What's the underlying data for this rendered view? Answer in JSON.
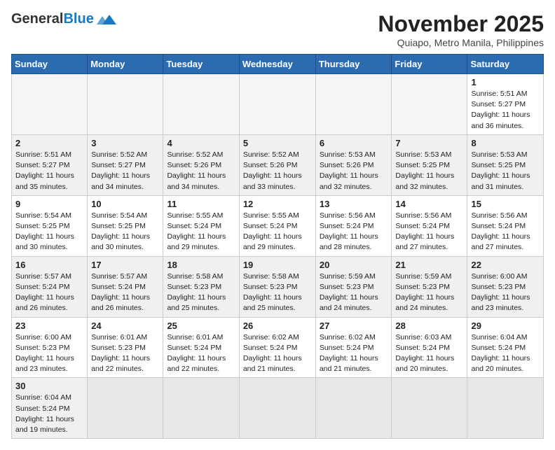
{
  "logo": {
    "general": "General",
    "blue": "Blue"
  },
  "header": {
    "month": "November 2025",
    "location": "Quiapo, Metro Manila, Philippines"
  },
  "weekdays": [
    "Sunday",
    "Monday",
    "Tuesday",
    "Wednesday",
    "Thursday",
    "Friday",
    "Saturday"
  ],
  "weeks": [
    [
      {
        "day": null,
        "info": null
      },
      {
        "day": null,
        "info": null
      },
      {
        "day": null,
        "info": null
      },
      {
        "day": null,
        "info": null
      },
      {
        "day": null,
        "info": null
      },
      {
        "day": null,
        "info": null
      },
      {
        "day": "1",
        "info": "Sunrise: 5:51 AM\nSunset: 5:27 PM\nDaylight: 11 hours\nand 36 minutes."
      }
    ],
    [
      {
        "day": "2",
        "info": "Sunrise: 5:51 AM\nSunset: 5:27 PM\nDaylight: 11 hours\nand 35 minutes."
      },
      {
        "day": "3",
        "info": "Sunrise: 5:52 AM\nSunset: 5:27 PM\nDaylight: 11 hours\nand 34 minutes."
      },
      {
        "day": "4",
        "info": "Sunrise: 5:52 AM\nSunset: 5:26 PM\nDaylight: 11 hours\nand 34 minutes."
      },
      {
        "day": "5",
        "info": "Sunrise: 5:52 AM\nSunset: 5:26 PM\nDaylight: 11 hours\nand 33 minutes."
      },
      {
        "day": "6",
        "info": "Sunrise: 5:53 AM\nSunset: 5:26 PM\nDaylight: 11 hours\nand 32 minutes."
      },
      {
        "day": "7",
        "info": "Sunrise: 5:53 AM\nSunset: 5:25 PM\nDaylight: 11 hours\nand 32 minutes."
      },
      {
        "day": "8",
        "info": "Sunrise: 5:53 AM\nSunset: 5:25 PM\nDaylight: 11 hours\nand 31 minutes."
      }
    ],
    [
      {
        "day": "9",
        "info": "Sunrise: 5:54 AM\nSunset: 5:25 PM\nDaylight: 11 hours\nand 30 minutes."
      },
      {
        "day": "10",
        "info": "Sunrise: 5:54 AM\nSunset: 5:25 PM\nDaylight: 11 hours\nand 30 minutes."
      },
      {
        "day": "11",
        "info": "Sunrise: 5:55 AM\nSunset: 5:24 PM\nDaylight: 11 hours\nand 29 minutes."
      },
      {
        "day": "12",
        "info": "Sunrise: 5:55 AM\nSunset: 5:24 PM\nDaylight: 11 hours\nand 29 minutes."
      },
      {
        "day": "13",
        "info": "Sunrise: 5:56 AM\nSunset: 5:24 PM\nDaylight: 11 hours\nand 28 minutes."
      },
      {
        "day": "14",
        "info": "Sunrise: 5:56 AM\nSunset: 5:24 PM\nDaylight: 11 hours\nand 27 minutes."
      },
      {
        "day": "15",
        "info": "Sunrise: 5:56 AM\nSunset: 5:24 PM\nDaylight: 11 hours\nand 27 minutes."
      }
    ],
    [
      {
        "day": "16",
        "info": "Sunrise: 5:57 AM\nSunset: 5:24 PM\nDaylight: 11 hours\nand 26 minutes."
      },
      {
        "day": "17",
        "info": "Sunrise: 5:57 AM\nSunset: 5:24 PM\nDaylight: 11 hours\nand 26 minutes."
      },
      {
        "day": "18",
        "info": "Sunrise: 5:58 AM\nSunset: 5:23 PM\nDaylight: 11 hours\nand 25 minutes."
      },
      {
        "day": "19",
        "info": "Sunrise: 5:58 AM\nSunset: 5:23 PM\nDaylight: 11 hours\nand 25 minutes."
      },
      {
        "day": "20",
        "info": "Sunrise: 5:59 AM\nSunset: 5:23 PM\nDaylight: 11 hours\nand 24 minutes."
      },
      {
        "day": "21",
        "info": "Sunrise: 5:59 AM\nSunset: 5:23 PM\nDaylight: 11 hours\nand 24 minutes."
      },
      {
        "day": "22",
        "info": "Sunrise: 6:00 AM\nSunset: 5:23 PM\nDaylight: 11 hours\nand 23 minutes."
      }
    ],
    [
      {
        "day": "23",
        "info": "Sunrise: 6:00 AM\nSunset: 5:23 PM\nDaylight: 11 hours\nand 23 minutes."
      },
      {
        "day": "24",
        "info": "Sunrise: 6:01 AM\nSunset: 5:23 PM\nDaylight: 11 hours\nand 22 minutes."
      },
      {
        "day": "25",
        "info": "Sunrise: 6:01 AM\nSunset: 5:24 PM\nDaylight: 11 hours\nand 22 minutes."
      },
      {
        "day": "26",
        "info": "Sunrise: 6:02 AM\nSunset: 5:24 PM\nDaylight: 11 hours\nand 21 minutes."
      },
      {
        "day": "27",
        "info": "Sunrise: 6:02 AM\nSunset: 5:24 PM\nDaylight: 11 hours\nand 21 minutes."
      },
      {
        "day": "28",
        "info": "Sunrise: 6:03 AM\nSunset: 5:24 PM\nDaylight: 11 hours\nand 20 minutes."
      },
      {
        "day": "29",
        "info": "Sunrise: 6:04 AM\nSunset: 5:24 PM\nDaylight: 11 hours\nand 20 minutes."
      }
    ],
    [
      {
        "day": "30",
        "info": "Sunrise: 6:04 AM\nSunset: 5:24 PM\nDaylight: 11 hours\nand 19 minutes."
      },
      {
        "day": null,
        "info": null
      },
      {
        "day": null,
        "info": null
      },
      {
        "day": null,
        "info": null
      },
      {
        "day": null,
        "info": null
      },
      {
        "day": null,
        "info": null
      },
      {
        "day": null,
        "info": null
      }
    ]
  ]
}
